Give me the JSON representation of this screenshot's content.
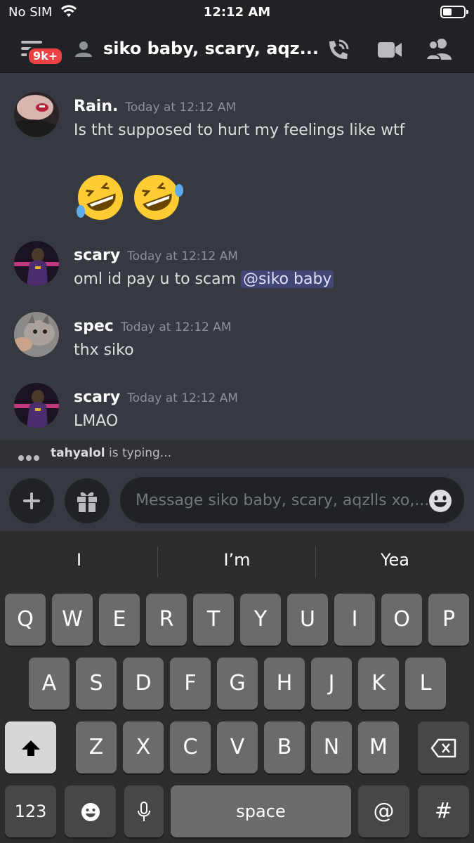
{
  "status_bar": {
    "carrier": "No SIM",
    "time": "12:12 AM"
  },
  "header": {
    "badge": "9k+",
    "title": "siko baby, scary, aqz..."
  },
  "messages": [
    {
      "author": "Rain.",
      "timestamp": "Today at 12:12 AM",
      "text": "Is tht supposed to hurt my feelings like wtf",
      "emoji": "🤣🤣"
    },
    {
      "author": "scary",
      "timestamp": "Today at 12:12 AM",
      "text": "oml id pay u to scam ",
      "mention": "@siko baby"
    },
    {
      "author": "spec",
      "timestamp": "Today at 12:12 AM",
      "text": "thx siko"
    },
    {
      "author": "scary",
      "timestamp": "Today at 12:12 AM",
      "text": "LMAO"
    }
  ],
  "typing": {
    "user": "tahyalol",
    "suffix": " is typing..."
  },
  "composer": {
    "placeholder": "Message siko baby, scary, aqzlls xo,..."
  },
  "keyboard": {
    "suggestions": [
      "I",
      "I’m",
      "Yea"
    ],
    "row1": [
      "Q",
      "W",
      "E",
      "R",
      "T",
      "Y",
      "U",
      "I",
      "O",
      "P"
    ],
    "row2": [
      "A",
      "S",
      "D",
      "F",
      "G",
      "H",
      "J",
      "K",
      "L"
    ],
    "row3": [
      "Z",
      "X",
      "C",
      "V",
      "B",
      "N",
      "M"
    ],
    "numbers_key": "123",
    "space_key": "space",
    "at_key": "@",
    "hash_key": "#"
  },
  "colors": {
    "background": "#36393f",
    "header": "#202225",
    "badge": "#ed4245",
    "mention_bg": "#414675"
  }
}
